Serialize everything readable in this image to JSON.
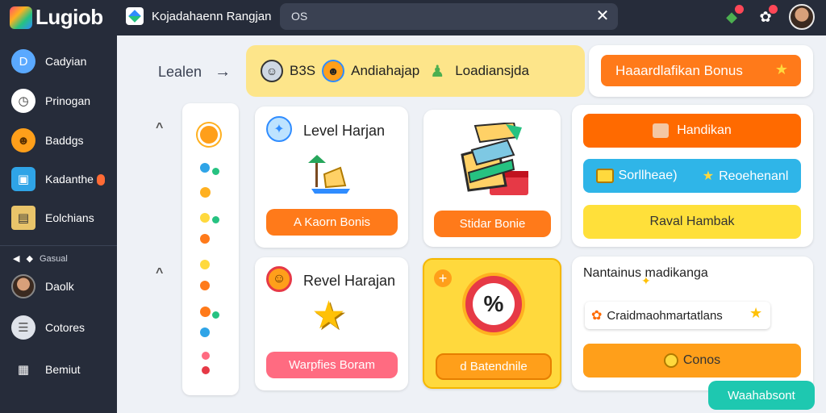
{
  "app": {
    "logo_text": "Lugiob",
    "title": "Kojadahaenn Rangjan"
  },
  "search": {
    "value": "OS"
  },
  "sidebar": {
    "items": [
      {
        "label": "Cadyian"
      },
      {
        "label": "Prinogan"
      },
      {
        "label": "Baddgs"
      },
      {
        "label": "Kadanthe"
      },
      {
        "label": "Eolchians"
      }
    ],
    "section_label": "Gasual",
    "items2": [
      {
        "label": "Daolk"
      },
      {
        "label": "Cotores"
      },
      {
        "label": "Bemiut"
      }
    ]
  },
  "breadcrumb": {
    "label": "Lealen"
  },
  "banner": {
    "item1": "B3S",
    "item2": "Andiahajap",
    "item3": "Loadiansjda"
  },
  "hero_button": {
    "label": "Haaardlafikan Bonus"
  },
  "cards": {
    "level1": {
      "title": "Level Harjan",
      "button": "A Kaorn Bonis"
    },
    "middle1": {
      "button": "Stidar Bonie"
    },
    "level2": {
      "title": "Revel Harajan",
      "button": "Warpfies Boram"
    },
    "middle2": {
      "button": "d Batendnile"
    }
  },
  "right_panel": {
    "btn1": "Handikan",
    "btn2_left": "Sorllheae)",
    "btn2_right": "Reoehenanl",
    "btn3": "Raval Hambak",
    "lower_title": "Nantainus madikanga",
    "lower_chip": "Craidmaohmartatlans",
    "lower_button": "Conos"
  },
  "fab": {
    "label": "Waahabsont"
  },
  "colors": {
    "orange": "#ff7a1a",
    "yellow": "#fde58a",
    "teal": "#1ec8b0",
    "dark": "#262c3a"
  }
}
